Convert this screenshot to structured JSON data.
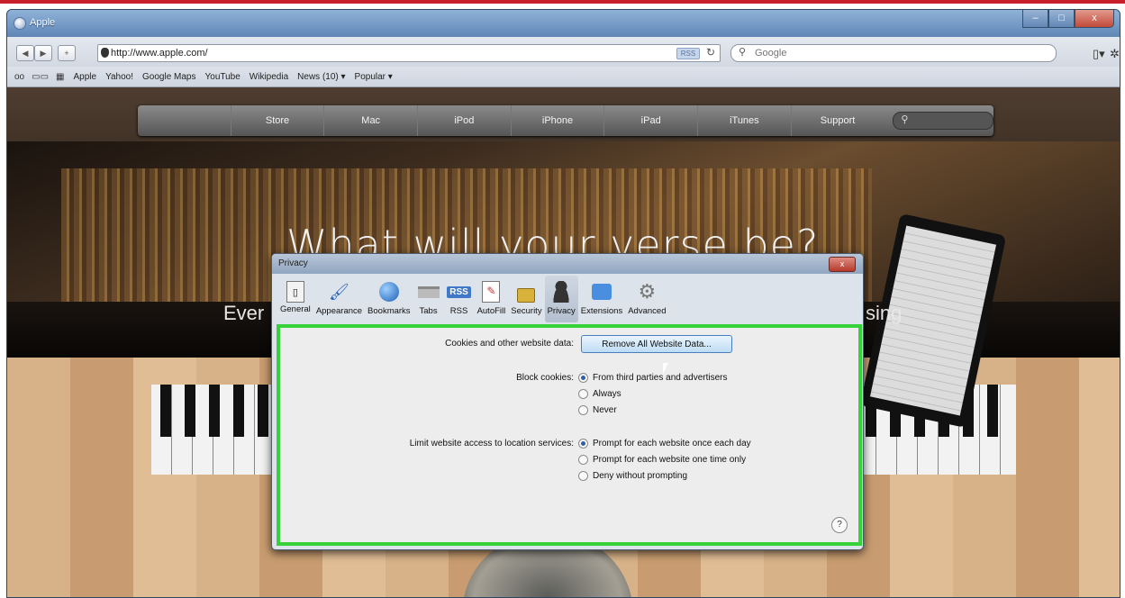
{
  "window": {
    "title": "Apple",
    "minimize": "–",
    "maximize": "□",
    "close": "x"
  },
  "toolbar": {
    "back": "◀",
    "forward": "▶",
    "add": "+",
    "address": "http://www.apple.com/",
    "rss": "RSS",
    "reload": "↻",
    "search_placeholder": "Google"
  },
  "bookmarks": [
    "Apple",
    "Yahoo!",
    "Google Maps",
    "YouTube",
    "Wikipedia",
    "News (10) ▾",
    "Popular ▾"
  ],
  "apple_nav": {
    "items": [
      "Store",
      "Mac",
      "iPod",
      "iPhone",
      "iPad",
      "iTunes",
      "Support"
    ]
  },
  "hero": {
    "headline": "What will your verse be?",
    "sub_left": "Ever",
    "sub_right": "sing"
  },
  "dialog": {
    "title": "Privacy",
    "close": "x",
    "tabs": [
      {
        "label": "General",
        "icon": "general-icon"
      },
      {
        "label": "Appearance",
        "icon": "appearance-icon"
      },
      {
        "label": "Bookmarks",
        "icon": "bookmarks-icon"
      },
      {
        "label": "Tabs",
        "icon": "tabs-icon"
      },
      {
        "label": "RSS",
        "icon": "rss-icon"
      },
      {
        "label": "AutoFill",
        "icon": "autofill-icon"
      },
      {
        "label": "Security",
        "icon": "lock-icon"
      },
      {
        "label": "Privacy",
        "icon": "person-icon"
      },
      {
        "label": "Extensions",
        "icon": "puzzle-icon"
      },
      {
        "label": "Advanced",
        "icon": "gear-icon"
      }
    ],
    "active_tab": "Privacy",
    "cookies_label": "Cookies and other website data:",
    "remove_button": "Remove All Website Data...",
    "block_label": "Block cookies:",
    "block_options": [
      {
        "label": "From third parties and advertisers",
        "selected": true
      },
      {
        "label": "Always",
        "selected": false
      },
      {
        "label": "Never",
        "selected": false
      }
    ],
    "location_label": "Limit website access to location services:",
    "location_options": [
      {
        "label": "Prompt for each website once each day",
        "selected": true
      },
      {
        "label": "Prompt for each website one time only",
        "selected": false
      },
      {
        "label": "Deny without prompting",
        "selected": false
      }
    ],
    "help": "?"
  },
  "colors": {
    "highlight": "#35d23a",
    "top_rule": "#c8202a"
  }
}
